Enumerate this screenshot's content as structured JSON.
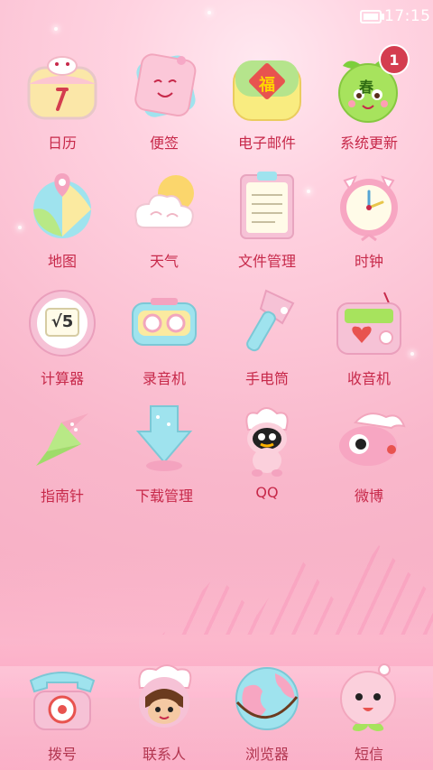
{
  "status_bar": {
    "time": "17:15",
    "battery": "battery-full-icon"
  },
  "apps": [
    {
      "label": "日历",
      "icon": "calendar-icon"
    },
    {
      "label": "便签",
      "icon": "notes-icon"
    },
    {
      "label": "电子邮件",
      "icon": "email-icon",
      "glyph": "福"
    },
    {
      "label": "系统更新",
      "icon": "system-update-icon",
      "glyph": "春",
      "badge": "1"
    },
    {
      "label": "地图",
      "icon": "map-icon"
    },
    {
      "label": "天气",
      "icon": "weather-icon"
    },
    {
      "label": "文件管理",
      "icon": "file-manager-icon"
    },
    {
      "label": "时钟",
      "icon": "clock-icon"
    },
    {
      "label": "计算器",
      "icon": "calculator-icon",
      "glyph": "√5"
    },
    {
      "label": "录音机",
      "icon": "recorder-icon"
    },
    {
      "label": "手电筒",
      "icon": "flashlight-icon"
    },
    {
      "label": "收音机",
      "icon": "radio-icon"
    },
    {
      "label": "指南针",
      "icon": "compass-icon"
    },
    {
      "label": "下载管理",
      "icon": "download-manager-icon"
    },
    {
      "label": "QQ",
      "icon": "qq-icon"
    },
    {
      "label": "微博",
      "icon": "weibo-icon"
    }
  ],
  "dock": [
    {
      "label": "拨号",
      "icon": "phone-icon"
    },
    {
      "label": "联系人",
      "icon": "contacts-icon"
    },
    {
      "label": "浏览器",
      "icon": "browser-icon"
    },
    {
      "label": "短信",
      "icon": "messages-icon"
    }
  ]
}
